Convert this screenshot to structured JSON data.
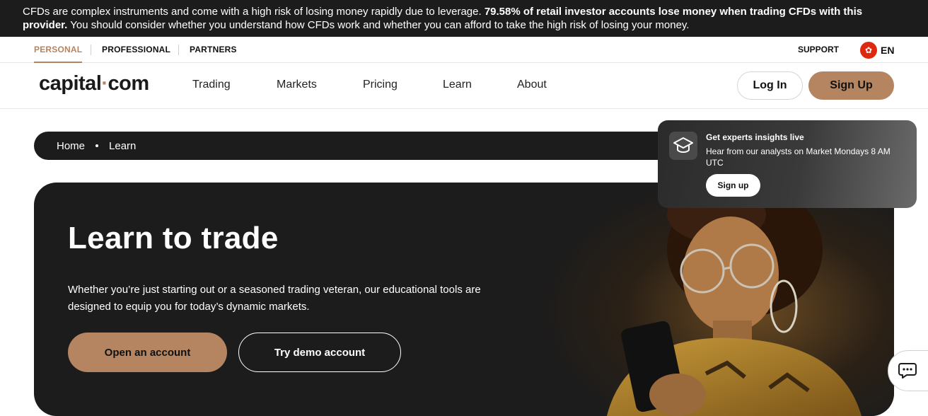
{
  "risk_warning": {
    "text_before": "CFDs are complex instruments and come with a high risk of losing money rapidly due to leverage. ",
    "bold": "79.58% of retail investor accounts lose money when trading CFDs with this provider.",
    "text_after": " You should consider whether you understand how CFDs work and whether you can afford to take the high risk of losing your money."
  },
  "segments": [
    {
      "label": "PERSONAL",
      "active": true
    },
    {
      "label": "PROFESSIONAL",
      "active": false
    },
    {
      "label": "PARTNERS",
      "active": false
    }
  ],
  "support_label": "SUPPORT",
  "language": {
    "flag_icon": "hong-kong-flag-icon",
    "label": "EN"
  },
  "header": {
    "logo_left": "capital",
    "logo_dot": "·",
    "logo_right": "com",
    "nav": [
      "Trading",
      "Markets",
      "Pricing",
      "Learn",
      "About"
    ],
    "login": "Log In",
    "signup": "Sign Up"
  },
  "breadcrumb": [
    "Home",
    "Learn"
  ],
  "hero": {
    "title": "Learn to trade",
    "text": "Whether you’re just starting out or a seasoned trading veteran, our educational tools are designed to equip you for today’s dynamic markets.",
    "primary_button": "Open an account",
    "secondary_button": "Try demo account"
  },
  "promo": {
    "icon": "graduation-cap-icon",
    "title": "Get experts insights live",
    "text": "Hear from our analysts on Market Mondays 8 AM UTC",
    "button": "Sign up"
  },
  "chat_icon": "chat-bubble-icon",
  "colors": {
    "accent": "#b48560",
    "dark": "#1c1c1c",
    "flag": "#de2910"
  }
}
